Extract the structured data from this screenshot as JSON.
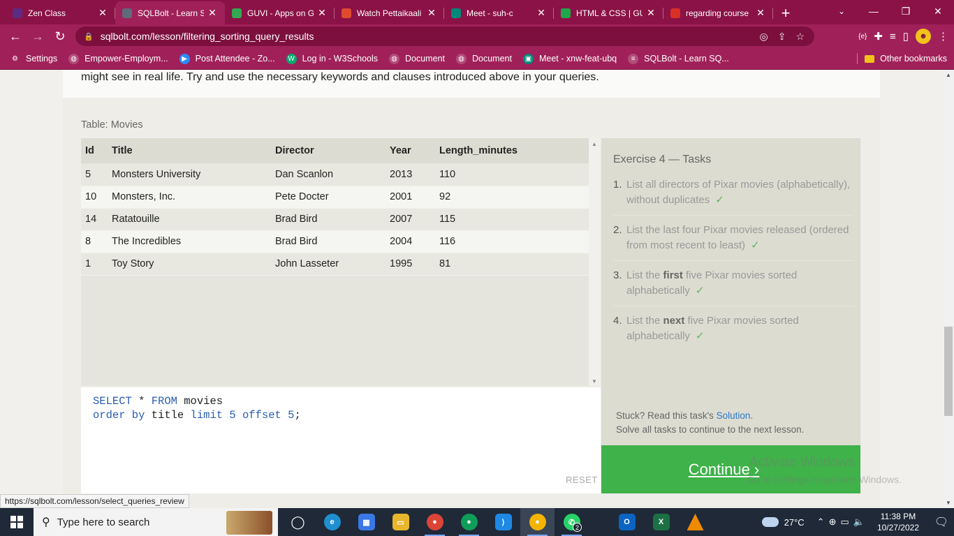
{
  "browser": {
    "tabs": [
      {
        "title": "Zen Class",
        "favicon_color": "#5b2c83",
        "active": false
      },
      {
        "title": "SQLBolt - Learn SQ",
        "favicon_color": "#5f6b7a",
        "active": true
      },
      {
        "title": "GUVI - Apps on Go",
        "favicon_color": "#34a853",
        "active": false
      },
      {
        "title": "Watch Pettaikaali",
        "favicon_color": "#e04b2f",
        "active": false
      },
      {
        "title": "Meet - suh-c",
        "favicon_color": "#00897b",
        "active": false
      },
      {
        "title": "HTML & CSS | GU",
        "favicon_color": "#1fa84a",
        "active": false
      },
      {
        "title": "regarding course",
        "favicon_color": "#d93025",
        "active": false
      }
    ],
    "url": "sqlbolt.com/lesson/filtering_sorting_query_results",
    "bookmarks": [
      {
        "label": "Settings",
        "icon": "gear-icon"
      },
      {
        "label": "Empower-Employm...",
        "icon": "globe-icon"
      },
      {
        "label": "Post Attendee - Zo...",
        "icon": "zoom-icon"
      },
      {
        "label": "Log in - W3Schools",
        "icon": "w3schools-icon"
      },
      {
        "label": "Document",
        "icon": "globe-icon"
      },
      {
        "label": "Document",
        "icon": "globe-icon"
      },
      {
        "label": "Meet - xnw-feat-ubq",
        "icon": "meet-icon"
      },
      {
        "label": "SQLBolt - Learn SQ...",
        "icon": "sqlbolt-icon"
      }
    ],
    "other_bookmarks": "Other bookmarks",
    "accent": "#a0215a"
  },
  "lesson": {
    "intro": "might see in real life. Try and use the necessary keywords and clauses introduced above in your queries.",
    "table_caption": "Table: Movies",
    "columns": [
      "Id",
      "Title",
      "Director",
      "Year",
      "Length_minutes"
    ],
    "rows": [
      [
        "5",
        "Monsters University",
        "Dan Scanlon",
        "2013",
        "110"
      ],
      [
        "10",
        "Monsters, Inc.",
        "Pete Docter",
        "2001",
        "92"
      ],
      [
        "14",
        "Ratatouille",
        "Brad Bird",
        "2007",
        "115"
      ],
      [
        "8",
        "The Incredibles",
        "Brad Bird",
        "2004",
        "116"
      ],
      [
        "1",
        "Toy Story",
        "John Lasseter",
        "1995",
        "81"
      ]
    ],
    "query": {
      "line1": [
        {
          "t": "SELECT",
          "k": true
        },
        {
          "t": " * ",
          "k": false
        },
        {
          "t": "FROM",
          "k": true
        },
        {
          "t": " movies",
          "k": false
        }
      ],
      "line2": [
        {
          "t": "order by",
          "k": true
        },
        {
          "t": " title ",
          "k": false
        },
        {
          "t": "limit",
          "k": true
        },
        {
          "t": " ",
          "k": false
        },
        {
          "t": "5",
          "k": true
        },
        {
          "t": " ",
          "k": false
        },
        {
          "t": "offset",
          "k": true
        },
        {
          "t": " ",
          "k": false
        },
        {
          "t": "5",
          "k": true
        },
        {
          "t": ";",
          "k": false
        }
      ]
    },
    "reset_label": "RESET",
    "tasks_title": "Exercise 4 — Tasks",
    "tasks": [
      {
        "num": "1.",
        "pre": "List all directors of Pixar movies (alphabetically), without duplicates",
        "bold": "",
        "post": "",
        "done": true
      },
      {
        "num": "2.",
        "pre": "List the last four Pixar movies released (ordered from most recent to least)",
        "bold": "",
        "post": "",
        "done": true
      },
      {
        "num": "3.",
        "pre": "List the ",
        "bold": "first",
        "post": " five Pixar movies sorted alphabetically",
        "done": true
      },
      {
        "num": "4.",
        "pre": "List the ",
        "bold": "next",
        "post": " five Pixar movies sorted alphabetically",
        "done": true
      }
    ],
    "check": "✓",
    "stuck_prefix": "Stuck? Read this task's ",
    "solution_link": "Solution",
    "stuck_suffix": ".",
    "solve_all": "Solve all tasks to continue to the next lesson.",
    "continue_label": "Continue ›"
  },
  "watermark": {
    "line1": "Activate Windows",
    "line2": "Go to Settings to activate Windows."
  },
  "status_link": "https://sqlbolt.com/lesson/select_queries_review",
  "taskbar": {
    "search_placeholder": "Type here to search",
    "weather": "27°C",
    "time": "11:38 PM",
    "date": "10/27/2022",
    "whatsapp_badge": "2"
  }
}
